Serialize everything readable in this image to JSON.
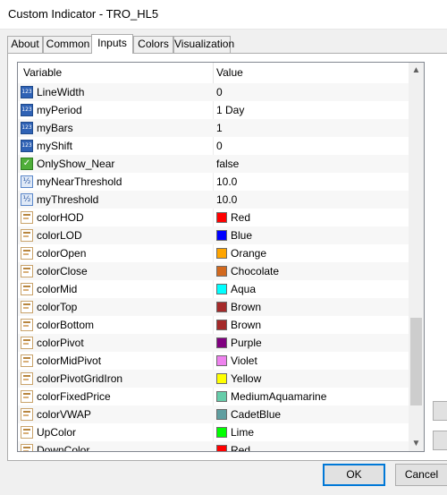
{
  "window": {
    "title": "Custom Indicator - TRO_HL5"
  },
  "tabs": [
    {
      "label": "About"
    },
    {
      "label": "Common"
    },
    {
      "label": "Inputs"
    },
    {
      "label": "Colors"
    },
    {
      "label": "Visualization"
    }
  ],
  "active_tab": "Inputs",
  "grid": {
    "columns": {
      "variable": "Variable",
      "value": "Value"
    },
    "rows": [
      {
        "type": "int",
        "name": "LineWidth",
        "value": "0"
      },
      {
        "type": "int",
        "name": "myPeriod",
        "value": "1 Day"
      },
      {
        "type": "int",
        "name": "myBars",
        "value": "1"
      },
      {
        "type": "int",
        "name": "myShift",
        "value": "0"
      },
      {
        "type": "bool",
        "name": "OnlyShow_Near",
        "value": "false"
      },
      {
        "type": "double",
        "name": "myNearThreshold",
        "value": "10.0"
      },
      {
        "type": "double",
        "name": "myThreshold",
        "value": "10.0"
      },
      {
        "type": "color",
        "name": "colorHOD",
        "value": "Red",
        "swatch": "#ff0000"
      },
      {
        "type": "color",
        "name": "colorLOD",
        "value": "Blue",
        "swatch": "#0000ff"
      },
      {
        "type": "color",
        "name": "colorOpen",
        "value": "Orange",
        "swatch": "#ffa500"
      },
      {
        "type": "color",
        "name": "colorClose",
        "value": "Chocolate",
        "swatch": "#d2691e"
      },
      {
        "type": "color",
        "name": "colorMid",
        "value": "Aqua",
        "swatch": "#00ffff"
      },
      {
        "type": "color",
        "name": "colorTop",
        "value": "Brown",
        "swatch": "#a52a2a"
      },
      {
        "type": "color",
        "name": "colorBottom",
        "value": "Brown",
        "swatch": "#a52a2a"
      },
      {
        "type": "color",
        "name": "colorPivot",
        "value": "Purple",
        "swatch": "#800080"
      },
      {
        "type": "color",
        "name": "colorMidPivot",
        "value": "Violet",
        "swatch": "#ee82ee"
      },
      {
        "type": "color",
        "name": "colorPivotGridIron",
        "value": "Yellow",
        "swatch": "#ffff00"
      },
      {
        "type": "color",
        "name": "colorFixedPrice",
        "value": "MediumAquamarine",
        "swatch": "#66cdaa"
      },
      {
        "type": "color",
        "name": "colorVWAP",
        "value": "CadetBlue",
        "swatch": "#5f9ea0"
      },
      {
        "type": "color",
        "name": "UpColor",
        "value": "Lime",
        "swatch": "#00ff00"
      },
      {
        "type": "color",
        "name": "DownColor",
        "value": "Red",
        "swatch": "#ff0000"
      }
    ]
  },
  "buttons": {
    "ok": "OK",
    "cancel": "Cancel"
  },
  "colors": {
    "accent": "#0078d7"
  }
}
